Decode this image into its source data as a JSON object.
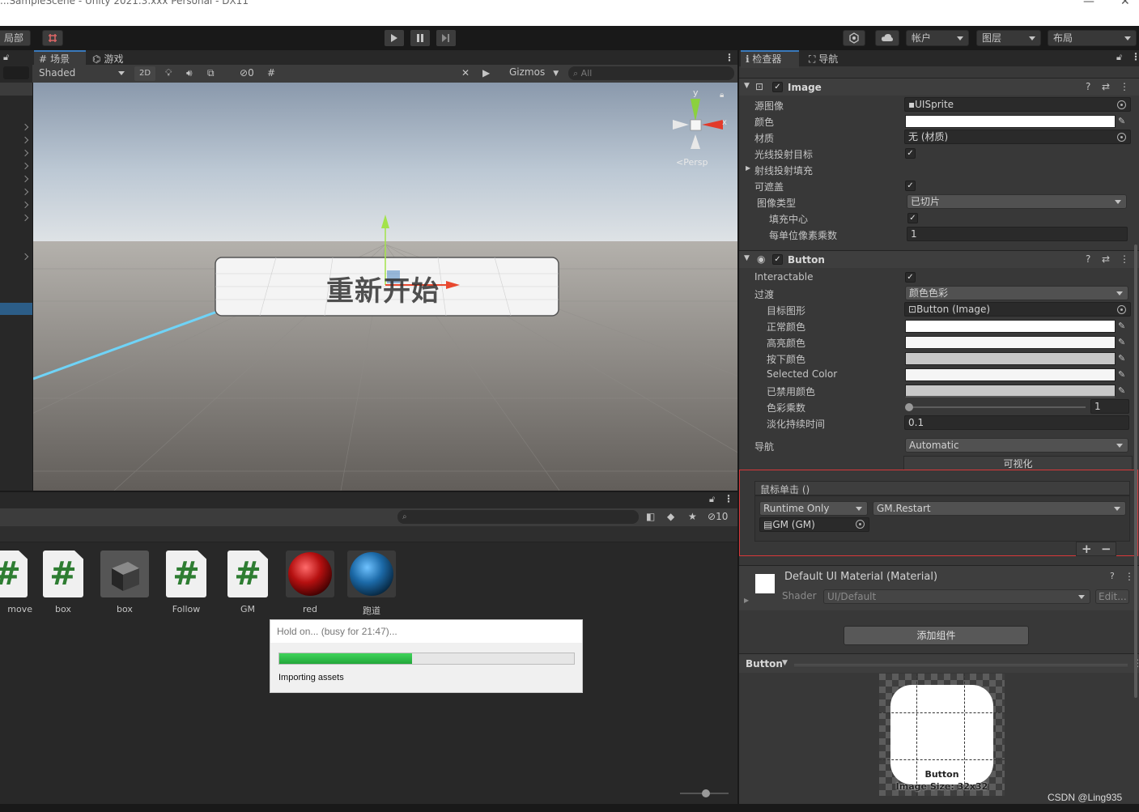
{
  "window": {
    "title": "...SampleScene - Unity 2021.3.xxx Personal - DX11"
  },
  "toolbar": {
    "local_label": "局部",
    "account_label": "帐户",
    "layers_label": "图层",
    "layout_label": "布局"
  },
  "scene_view": {
    "tabs": [
      "场景",
      "游戏"
    ],
    "shading_mode": "Shaded",
    "mode_2d": "2D",
    "hidden_count": "0",
    "gizmos_label": "Gizmos",
    "search_placeholder": "All",
    "persp_label": "<Persp",
    "gizmo_axes": {
      "y": "y",
      "x": "x"
    },
    "button_text": "重新开始"
  },
  "project": {
    "hidden_count": "10",
    "assets": [
      {
        "name": "move",
        "kind": "script"
      },
      {
        "name": "box",
        "kind": "script"
      },
      {
        "name": "box",
        "kind": "model"
      },
      {
        "name": "Follow",
        "kind": "script"
      },
      {
        "name": "GM",
        "kind": "script"
      },
      {
        "name": "red",
        "kind": "material-red"
      },
      {
        "name": "跑道",
        "kind": "material-blue"
      }
    ],
    "busy_dialog": {
      "title": "Hold on... (busy for 21:47)...",
      "progress": 0.45,
      "message": "Importing assets"
    }
  },
  "inspector": {
    "tabs": [
      "检查器",
      "导航"
    ],
    "image_component": {
      "name": "Image",
      "source_image_label": "源图像",
      "source_image_value": "UISprite",
      "color_label": "颜色",
      "material_label": "材质",
      "material_value": "无 (材质)",
      "raycast_target_label": "光线投射目标",
      "raycast_padding_label": "射线投射填充",
      "maskable_label": "可遮盖",
      "image_type_label": "图像类型",
      "image_type_value": "已切片",
      "fill_center_label": "填充中心",
      "ppu_multiplier_label": "每单位像素乘数",
      "ppu_multiplier_value": "1"
    },
    "button_component": {
      "name": "Button",
      "interactable_label": "Interactable",
      "transition_label": "过渡",
      "transition_value": "颜色色彩",
      "target_graphic_label": "目标图形",
      "target_graphic_value": "Button (Image)",
      "normal_color_label": "正常颜色",
      "highlighted_color_label": "高亮颜色",
      "pressed_color_label": "按下颜色",
      "selected_color_label": "Selected Color",
      "disabled_color_label": "已禁用颜色",
      "color_multiplier_label": "色彩乘数",
      "color_multiplier_value": "1",
      "fade_duration_label": "淡化持续时间",
      "fade_duration_value": "0.1",
      "navigation_label": "导航",
      "navigation_value": "Automatic",
      "visualize_label": "可视化",
      "onclick_label": "鼠标单击 ()",
      "runtime_value": "Runtime Only",
      "function_value": "GM.Restart",
      "object_value": "GM (GM)",
      "add_label": "+",
      "remove_label": "−"
    },
    "material": {
      "name": "Default UI Material (Material)",
      "shader_label": "Shader",
      "shader_value": "UI/Default",
      "edit_label": "Edit..."
    },
    "add_component_label": "添加组件",
    "preview": {
      "title": "Button",
      "caption_name": "Button",
      "caption_size": "Image Size: 32x32"
    }
  },
  "watermark": "CSDN @Ling935",
  "colors": {
    "highlight_box": "#d9383a",
    "accent_blue": "#3a79bb",
    "progress_green": "#2fbf4a"
  }
}
